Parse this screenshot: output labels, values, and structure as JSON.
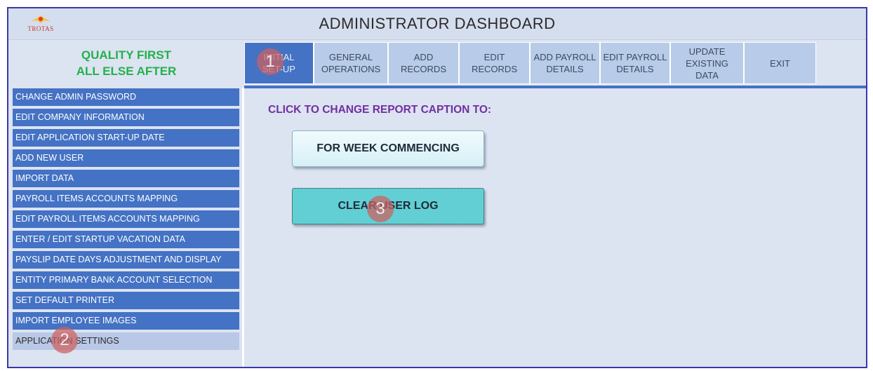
{
  "window": {
    "title": "ADMINISTRATOR DASHBOARD",
    "logo_text": "TROTAS"
  },
  "motto": {
    "line1": "QUALITY FIRST",
    "line2": "ALL ELSE AFTER"
  },
  "tabs": [
    {
      "label": "INITIAL\nSET-UP",
      "active": true
    },
    {
      "label": "GENERAL\nOPERATIONS"
    },
    {
      "label": "ADD\nRECORDS"
    },
    {
      "label": "EDIT\nRECORDS"
    },
    {
      "label": "ADD PAYROLL\nDETAILS"
    },
    {
      "label": "EDIT PAYROLL\nDETAILS"
    },
    {
      "label": "UPDATE\nEXISTING\nDATA"
    },
    {
      "label": "EXIT"
    }
  ],
  "sidebar": {
    "items": [
      {
        "label": "CHANGE ADMIN PASSWORD"
      },
      {
        "label": "EDIT COMPANY INFORMATION"
      },
      {
        "label": "EDIT APPLICATION START-UP DATE"
      },
      {
        "label": "ADD NEW USER"
      },
      {
        "label": "IMPORT DATA"
      },
      {
        "label": "PAYROLL ITEMS ACCOUNTS MAPPING"
      },
      {
        "label": "EDIT PAYROLL ITEMS ACCOUNTS MAPPING"
      },
      {
        "label": "ENTER / EDIT STARTUP VACATION DATA"
      },
      {
        "label": "PAYSLIP DATE DAYS ADJUSTMENT AND DISPLAY"
      },
      {
        "label": "ENTITY PRIMARY BANK ACCOUNT SELECTION"
      },
      {
        "label": "SET DEFAULT PRINTER"
      },
      {
        "label": "IMPORT EMPLOYEE IMAGES"
      },
      {
        "label": "APPLICATION SETTINGS"
      }
    ]
  },
  "main": {
    "caption": "CLICK TO CHANGE REPORT CAPTION TO:",
    "button_week": "FOR WEEK COMMENCING",
    "button_clear": "CLEAR USER LOG"
  },
  "markers": {
    "m1": "1",
    "m2": "2",
    "m3": "3"
  },
  "colors": {
    "accent": "#4472c4",
    "motto_green": "#22b14c",
    "caption_purple": "#7030a0",
    "clear_button": "#61cfd3"
  }
}
